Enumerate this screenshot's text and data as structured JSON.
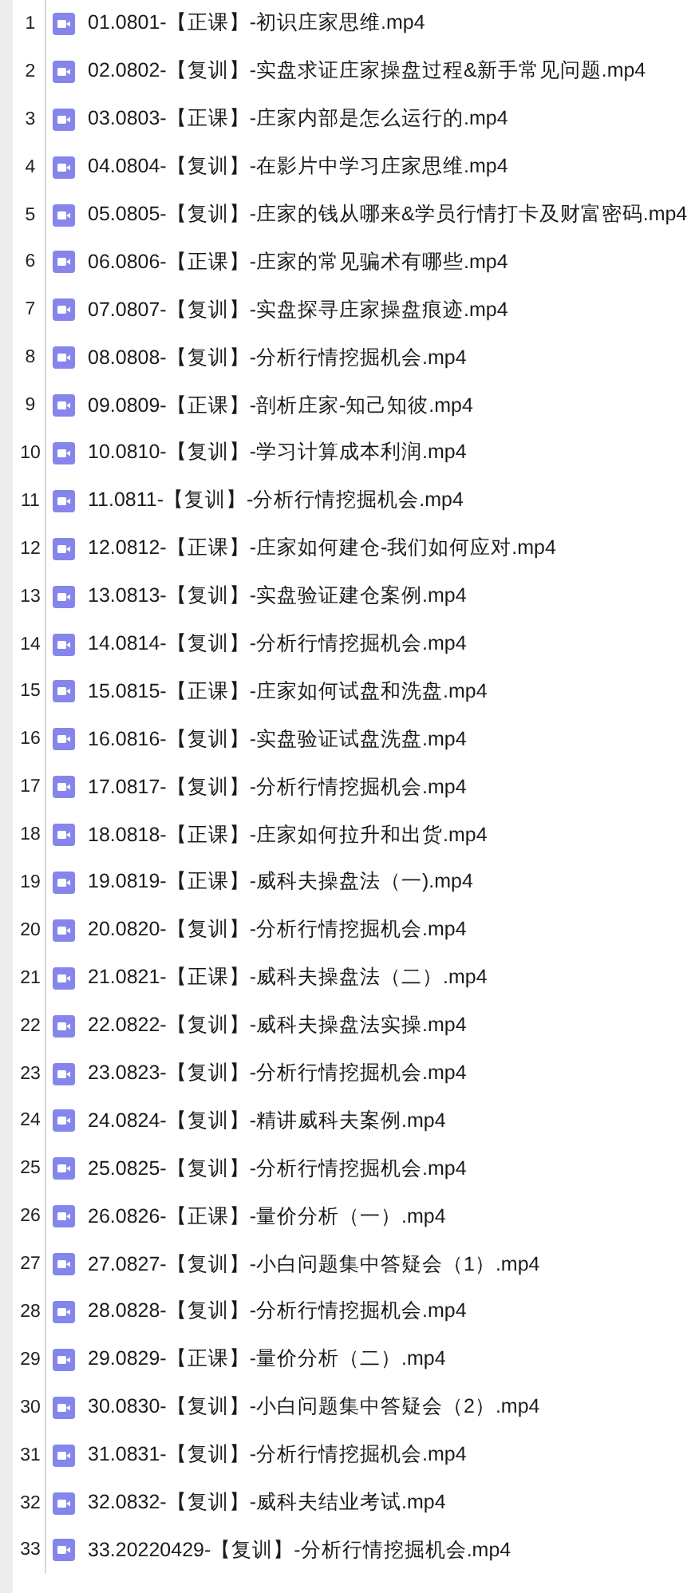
{
  "files": [
    {
      "number": "1",
      "name": "01.0801-【正课】-初识庄家思维.mp4"
    },
    {
      "number": "2",
      "name": "02.0802-【复训】-实盘求证庄家操盘过程&新手常见问题.mp4"
    },
    {
      "number": "3",
      "name": "03.0803-【正课】-庄家内部是怎么运行的.mp4"
    },
    {
      "number": "4",
      "name": "04.0804-【复训】-在影片中学习庄家思维.mp4"
    },
    {
      "number": "5",
      "name": "05.0805-【复训】-庄家的钱从哪来&学员行情打卡及财富密码.mp4"
    },
    {
      "number": "6",
      "name": "06.0806-【正课】-庄家的常见骗术有哪些.mp4"
    },
    {
      "number": "7",
      "name": "07.0807-【复训】-实盘探寻庄家操盘痕迹.mp4"
    },
    {
      "number": "8",
      "name": "08.0808-【复训】-分析行情挖掘机会.mp4"
    },
    {
      "number": "9",
      "name": "09.0809-【正课】-剖析庄家-知己知彼.mp4"
    },
    {
      "number": "10",
      "name": "10.0810-【复训】-学习计算成本利润.mp4"
    },
    {
      "number": "11",
      "name": "11.0811-【复训】-分析行情挖掘机会.mp4"
    },
    {
      "number": "12",
      "name": "12.0812-【正课】-庄家如何建仓-我们如何应对.mp4"
    },
    {
      "number": "13",
      "name": "13.0813-【复训】-实盘验证建仓案例.mp4"
    },
    {
      "number": "14",
      "name": "14.0814-【复训】-分析行情挖掘机会.mp4"
    },
    {
      "number": "15",
      "name": "15.0815-【正课】-庄家如何试盘和洗盘.mp4"
    },
    {
      "number": "16",
      "name": "16.0816-【复训】-实盘验证试盘洗盘.mp4"
    },
    {
      "number": "17",
      "name": "17.0817-【复训】-分析行情挖掘机会.mp4"
    },
    {
      "number": "18",
      "name": "18.0818-【正课】-庄家如何拉升和出货.mp4"
    },
    {
      "number": "19",
      "name": "19.0819-【正课】-威科夫操盘法（一).mp4"
    },
    {
      "number": "20",
      "name": "20.0820-【复训】-分析行情挖掘机会.mp4"
    },
    {
      "number": "21",
      "name": "21.0821-【正课】-威科夫操盘法（二）.mp4"
    },
    {
      "number": "22",
      "name": "22.0822-【复训】-威科夫操盘法实操.mp4"
    },
    {
      "number": "23",
      "name": "23.0823-【复训】-分析行情挖掘机会.mp4"
    },
    {
      "number": "24",
      "name": "24.0824-【复训】-精讲威科夫案例.mp4"
    },
    {
      "number": "25",
      "name": "25.0825-【复训】-分析行情挖掘机会.mp4"
    },
    {
      "number": "26",
      "name": "26.0826-【正课】-量价分析（一）.mp4"
    },
    {
      "number": "27",
      "name": "27.0827-【复训】-小白问题集中答疑会（1）.mp4"
    },
    {
      "number": "28",
      "name": "28.0828-【复训】-分析行情挖掘机会.mp4"
    },
    {
      "number": "29",
      "name": "29.0829-【正课】-量价分析（二）.mp4"
    },
    {
      "number": "30",
      "name": "30.0830-【复训】-小白问题集中答疑会（2）.mp4"
    },
    {
      "number": "31",
      "name": "31.0831-【复训】-分析行情挖掘机会.mp4"
    },
    {
      "number": "32",
      "name": "32.0832-【复训】-威科夫结业考试.mp4"
    },
    {
      "number": "33",
      "name": "33.20220429-【复训】-分析行情挖掘机会.mp4"
    }
  ]
}
